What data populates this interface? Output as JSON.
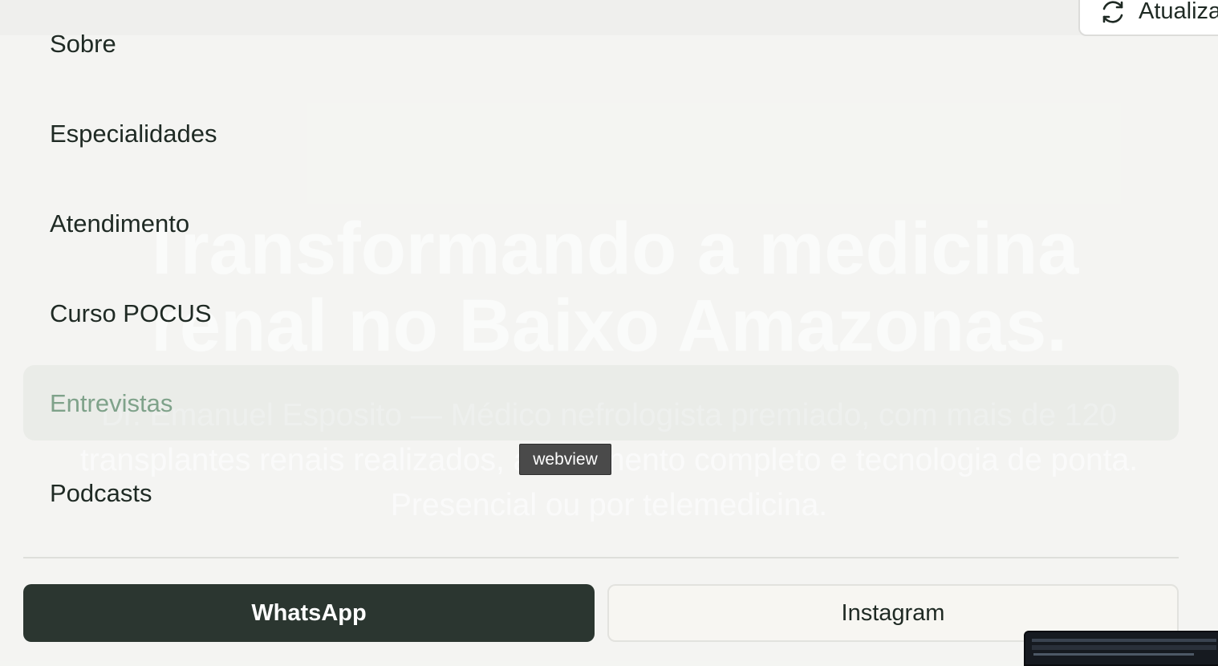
{
  "toolbar": {
    "refresh_label": "Atualizar"
  },
  "hero": {
    "title_line1": "Transformando a medicina",
    "title_line2": "renal no Baixo Amazonas.",
    "subtitle": "Dr. Emanuel Esposito — Médico nefrologista premiado, com mais de 120 transplantes renais realizados, atendimento completo e tecnologia de ponta. Presencial ou por telemedicina."
  },
  "menu": {
    "items": [
      {
        "label": "Sobre"
      },
      {
        "label": "Especialidades"
      },
      {
        "label": "Atendimento"
      },
      {
        "label": "Curso POCUS"
      },
      {
        "label": "Entrevistas"
      },
      {
        "label": "Podcasts"
      }
    ],
    "active_item": "Entrevistas"
  },
  "actions": {
    "whatsapp_label": "WhatsApp",
    "instagram_label": "Instagram"
  },
  "tooltip": {
    "text": "webview"
  },
  "colors": {
    "primary_button": "#2b3630",
    "active_menu_text": "#7fa28a",
    "menu_text": "#1f2a24",
    "background": "#f4f5f2"
  }
}
